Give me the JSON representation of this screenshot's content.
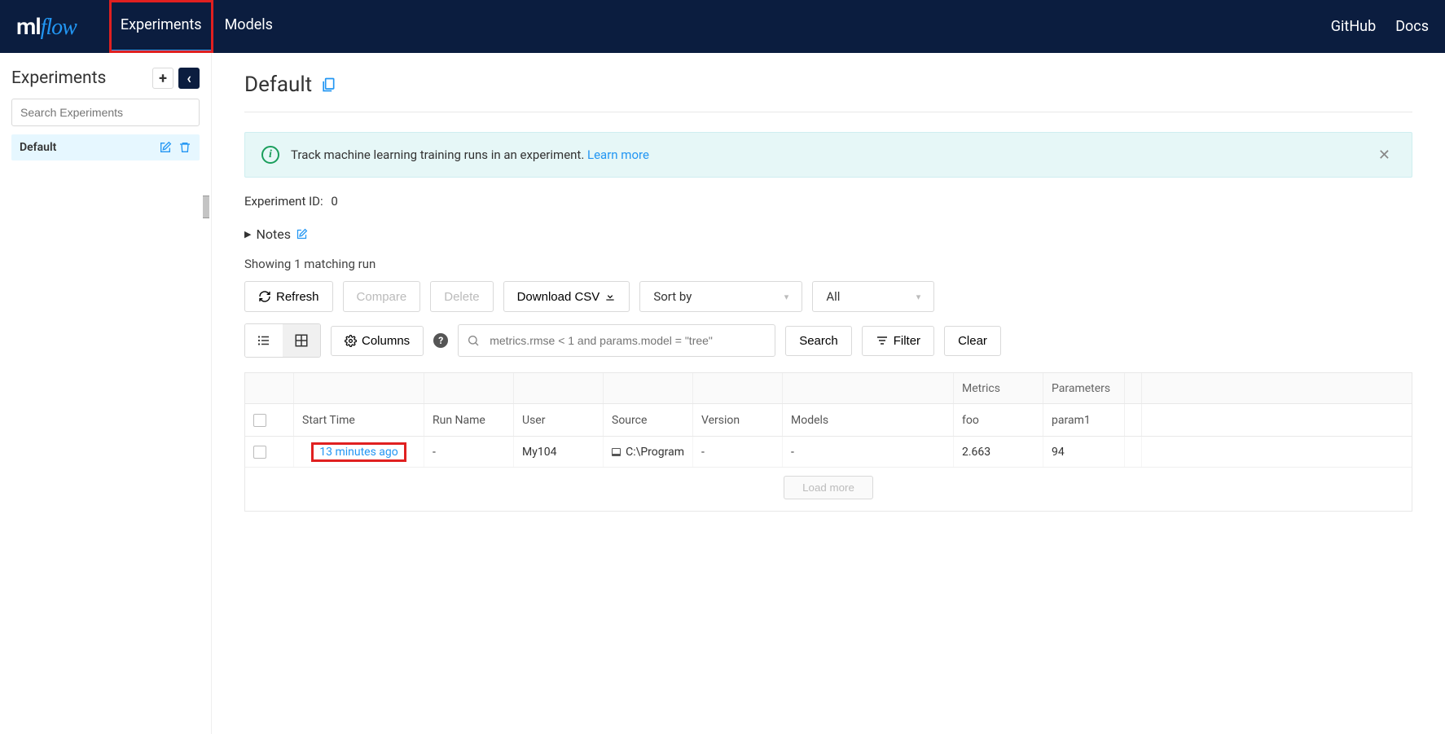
{
  "header": {
    "logo_ml": "ml",
    "logo_flow": "flow",
    "tabs": {
      "experiments": "Experiments",
      "models": "Models"
    },
    "links": {
      "github": "GitHub",
      "docs": "Docs"
    }
  },
  "sidebar": {
    "title": "Experiments",
    "search_placeholder": "Search Experiments",
    "items": [
      {
        "name": "Default"
      }
    ]
  },
  "page": {
    "title": "Default",
    "banner_text": "Track machine learning training runs in an experiment. ",
    "banner_link": "Learn more",
    "exp_id_label": "Experiment ID:",
    "exp_id_value": "0",
    "notes_label": "Notes",
    "showing_text": "Showing 1 matching run"
  },
  "toolbar": {
    "refresh": "Refresh",
    "compare": "Compare",
    "delete": "Delete",
    "download": "Download CSV",
    "sortby": "Sort by",
    "filter_all": "All",
    "columns": "Columns",
    "search_placeholder": "metrics.rmse < 1 and params.model = \"tree\"",
    "search_btn": "Search",
    "filter_btn": "Filter",
    "clear_btn": "Clear"
  },
  "table": {
    "group_headers": {
      "metrics": "Metrics",
      "parameters": "Parameters"
    },
    "headers": {
      "start_time": "Start Time",
      "run_name": "Run Name",
      "user": "User",
      "source": "Source",
      "version": "Version",
      "models": "Models",
      "foo": "foo",
      "param1": "param1"
    },
    "rows": [
      {
        "start_time": "13 minutes ago",
        "run_name": "-",
        "user": "My104",
        "source": "C:\\Program",
        "version": "-",
        "models": "-",
        "foo": "2.663",
        "param1": "94"
      }
    ],
    "load_more": "Load more"
  }
}
